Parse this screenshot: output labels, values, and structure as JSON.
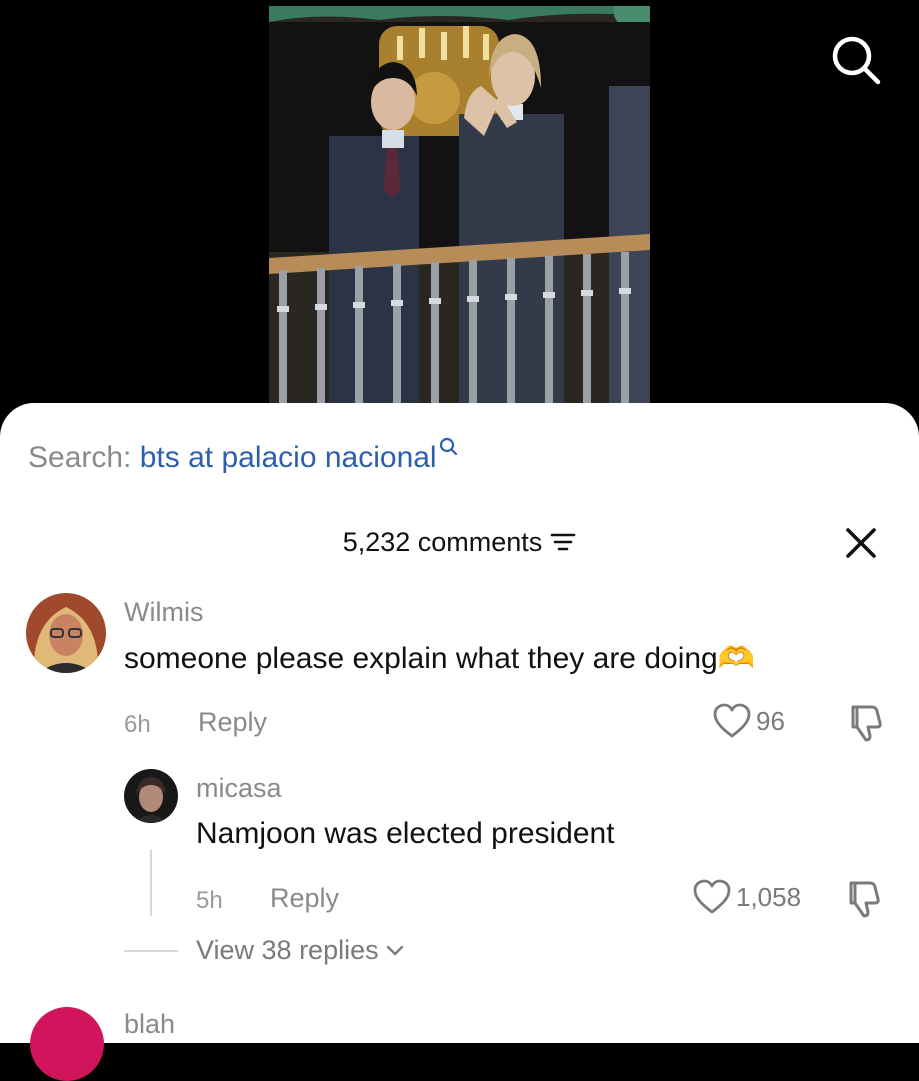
{
  "header": {
    "search_icon": "search-icon"
  },
  "search": {
    "prefix": "Search: ",
    "query": "bts at palacio nacional",
    "icon": "search-icon"
  },
  "comments_header": {
    "count_label": "5,232 comments",
    "filter_icon": "filter-icon",
    "close_icon": "close-icon"
  },
  "comments": [
    {
      "username": "Wilmis",
      "text": "someone please explain what they are doing",
      "emoji": "🫶",
      "time": "6h",
      "reply_label": "Reply",
      "likes": "96",
      "avatar_icon": "avatar",
      "reply": {
        "username": "micasa",
        "text": "Namjoon was elected president",
        "time": "5h",
        "reply_label": "Reply",
        "likes": "1,058",
        "avatar_icon": "avatar"
      },
      "view_replies_label": "View 38 replies"
    },
    {
      "username": "blah",
      "avatar_color": "#d0155c"
    }
  ]
}
